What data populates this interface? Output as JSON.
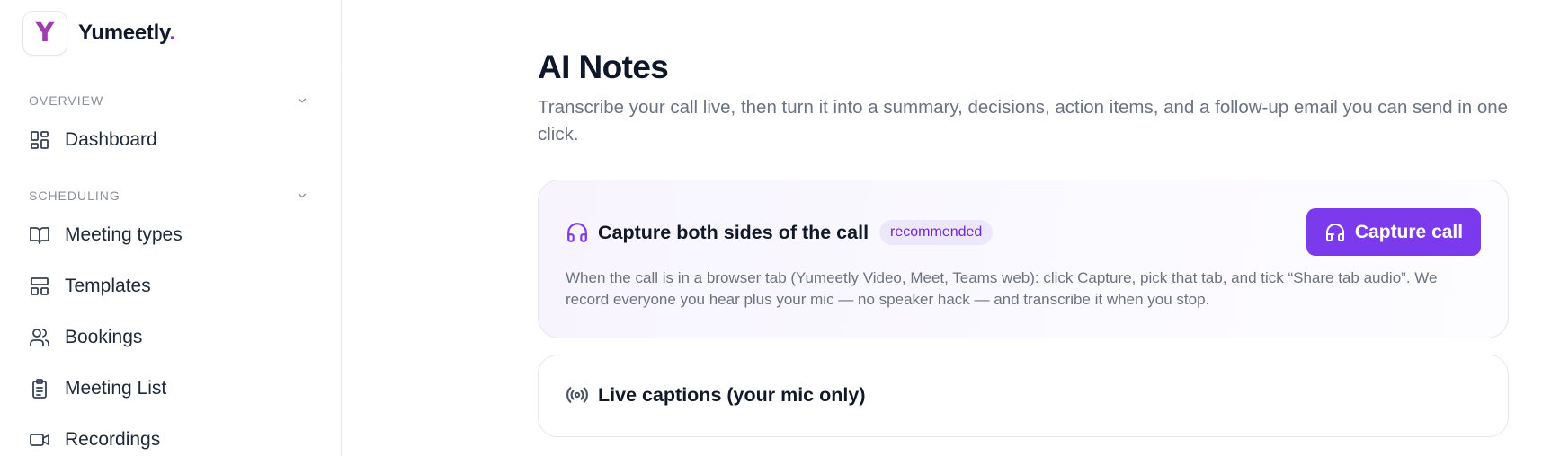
{
  "brand": {
    "letter": "Y",
    "name": "Yumeetly",
    "dot": "."
  },
  "sidebar": {
    "sections": [
      {
        "label": "OVERVIEW",
        "items": [
          {
            "label": "Dashboard",
            "icon": "dashboard-icon"
          }
        ]
      },
      {
        "label": "SCHEDULING",
        "items": [
          {
            "label": "Meeting types",
            "icon": "book-icon"
          },
          {
            "label": "Templates",
            "icon": "template-icon"
          },
          {
            "label": "Bookings",
            "icon": "users-icon"
          },
          {
            "label": "Meeting List",
            "icon": "clipboard-icon"
          },
          {
            "label": "Recordings",
            "icon": "video-icon"
          }
        ]
      }
    ]
  },
  "main": {
    "title": "AI Notes",
    "description": "Transcribe your call live, then turn it into a summary, decisions, action items, and a follow-up email you can send in one click.",
    "capture_card": {
      "title": "Capture both sides of the call",
      "badge": "recommended",
      "button_label": "Capture call",
      "body": "When the call is in a browser tab (Yumeetly Video, Meet, Teams web): click Capture, pick that tab, and tick “Share tab audio”. We record everyone you hear plus your mic — no speaker hack — and transcribe it when you stop."
    },
    "captions_card": {
      "title": "Live captions (your mic only)"
    }
  },
  "colors": {
    "accent": "#7c3aed",
    "logo": "#a03bb0",
    "badge_bg": "#ede7fb"
  }
}
